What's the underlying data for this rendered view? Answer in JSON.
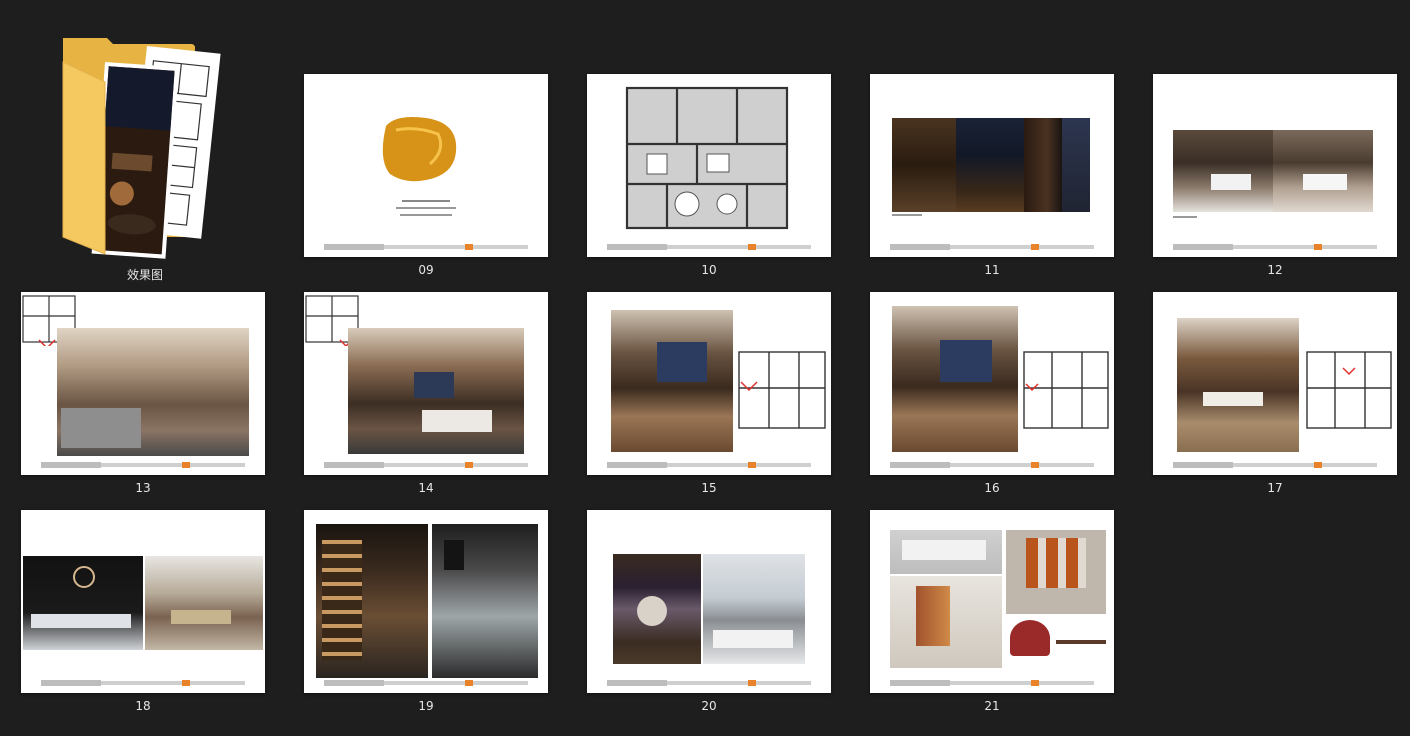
{
  "folder": {
    "name": "效果图"
  },
  "thumbnails": [
    {
      "label": "09"
    },
    {
      "label": "10"
    },
    {
      "label": "11"
    },
    {
      "label": "12"
    },
    {
      "label": "13"
    },
    {
      "label": "14"
    },
    {
      "label": "15"
    },
    {
      "label": "16"
    },
    {
      "label": "17"
    },
    {
      "label": "18"
    },
    {
      "label": "19"
    },
    {
      "label": "20"
    },
    {
      "label": "21"
    }
  ],
  "colors": {
    "background": "#1e1e1e",
    "accent": "#e8832a",
    "folder": "#f6c960"
  }
}
